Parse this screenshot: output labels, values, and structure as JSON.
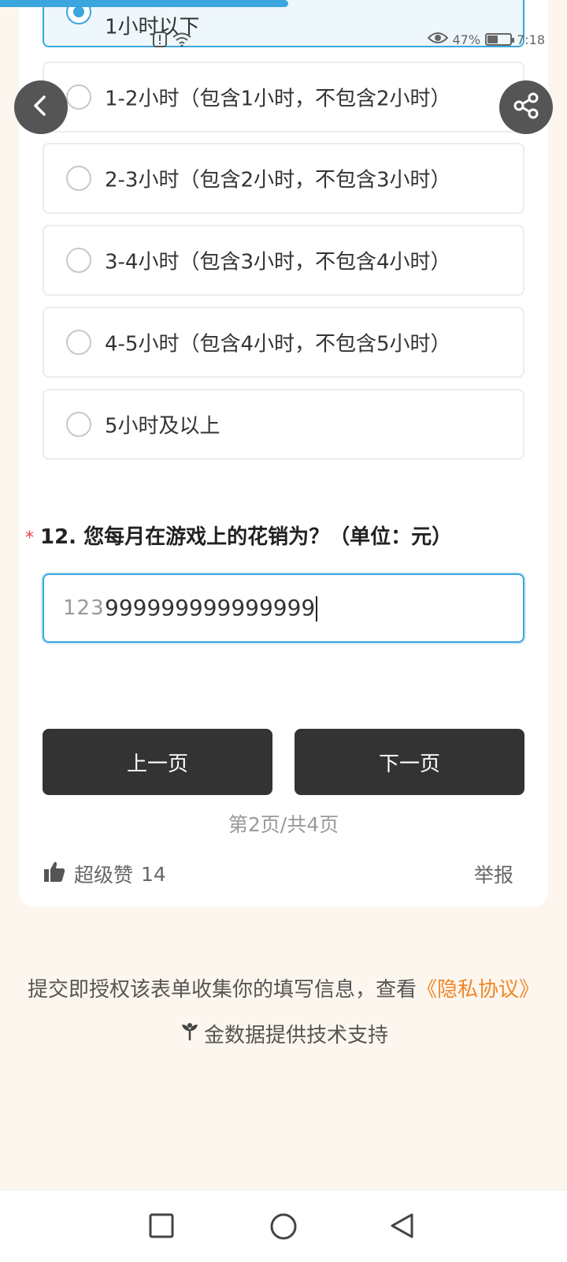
{
  "status_bar": {
    "battery_text": "47%",
    "battery_level": 0.47,
    "time": "7:18"
  },
  "question11": {
    "options": [
      {
        "label": "1小时以下",
        "selected": true
      },
      {
        "label": "1-2小时（包含1小时，不包含2小时）",
        "selected": false
      },
      {
        "label": "2-3小时（包含2小时，不包含3小时）",
        "selected": false
      },
      {
        "label": "3-4小时（包含3小时，不包含4小时）",
        "selected": false
      },
      {
        "label": "4-5小时（包含4小时，不包含5小时）",
        "selected": false
      },
      {
        "label": "5小时及以上",
        "selected": false
      }
    ]
  },
  "question12": {
    "required_mark": "*",
    "title": "12. 您每月在游戏上的花销为？（单位：元）",
    "input_icon": "123",
    "input_value": "999999999999999"
  },
  "nav": {
    "prev_label": "上一页",
    "next_label": "下一页",
    "page_indicator": "第2页/共4页"
  },
  "footer_actions": {
    "like_label": "超级赞",
    "like_count": "14",
    "report_label": "举报"
  },
  "privacy": {
    "text": "提交即授权该表单收集你的填写信息，查看",
    "link": "《隐私协议》"
  },
  "support": {
    "text": "金数据提供技术支持"
  },
  "colors": {
    "accent": "#3aa6dd",
    "link": "#f0872a",
    "button": "#333333",
    "background": "#fdf6ee"
  }
}
